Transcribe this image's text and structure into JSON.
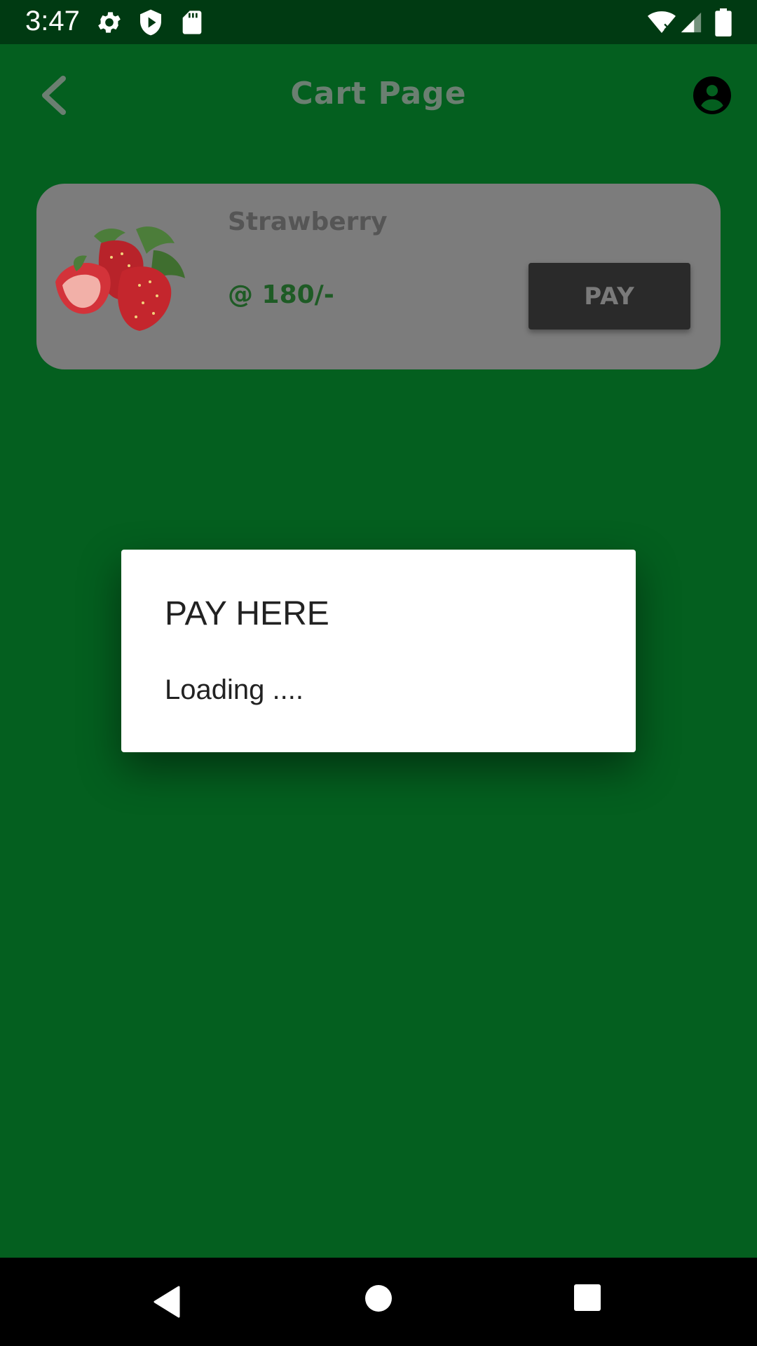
{
  "status_bar": {
    "time": "3:47",
    "left_icons": [
      "settings-icon",
      "shield-play-icon",
      "sd-card-icon"
    ],
    "right_icons": [
      "wifi-off-icon",
      "cell-signal-icon",
      "battery-icon"
    ]
  },
  "app_bar": {
    "title": "Cart Page",
    "back_icon": "chevron-left-icon",
    "account_icon": "account-circle-icon"
  },
  "cart": {
    "items": [
      {
        "name": "Strawberry",
        "price": "@ 180/-",
        "pay_label": "PAY",
        "image": "strawberry-image"
      }
    ]
  },
  "dialog": {
    "title": "PAY HERE",
    "message": "Loading ...."
  },
  "navigation": {
    "icons": [
      "nav-back-icon",
      "nav-home-icon",
      "nav-recents-icon"
    ]
  },
  "colors": {
    "background": "#045f1f",
    "status_bar": "#003a12",
    "card": "#7c7c7c",
    "pay_button": "#2a2a2a",
    "price_text": "#1e5b25"
  }
}
